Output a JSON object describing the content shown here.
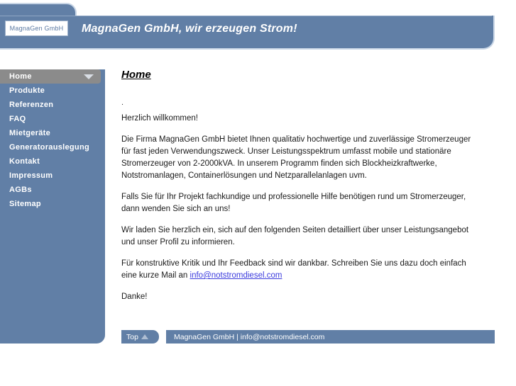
{
  "header": {
    "logo_text": "MagnaGen GmbH",
    "title": "MagnaGen GmbH, wir erzeugen Strom!",
    "dropdown_icon": "chevron-down-icon"
  },
  "sidebar": {
    "items": [
      {
        "label": "Home",
        "active": true
      },
      {
        "label": "Produkte",
        "active": false
      },
      {
        "label": "Referenzen",
        "active": false
      },
      {
        "label": "FAQ",
        "active": false
      },
      {
        "label": "Mietgeräte",
        "active": false
      },
      {
        "label": "Generatorauslegung",
        "active": false
      },
      {
        "label": "Kontakt",
        "active": false
      },
      {
        "label": "Impressum",
        "active": false
      },
      {
        "label": "AGBs",
        "active": false
      },
      {
        "label": "Sitemap",
        "active": false
      }
    ]
  },
  "main": {
    "page_title": "Home",
    "dot": ".",
    "greeting": "Herzlich willkommen!",
    "paragraph_1": "Die Firma MagnaGen GmbH bietet Ihnen qualitativ hochwertige und zuverlässige Stromerzeuger für fast jeden Verwendungszweck. Unser Leistungsspektrum umfasst mobile und stationäre Stromerzeuger von 2-2000kVA. In unserem Programm finden sich Blockheizkraftwerke, Notstromanlagen, Containerlösungen und Netzparallelanlagen uvm.",
    "paragraph_2": "Falls Sie für Ihr Projekt fachkundige und professionelle Hilfe benötigen rund um Stromerzeuger, dann wenden Sie sich an uns!",
    "paragraph_3": "Wir laden Sie herzlich ein, sich auf den folgenden Seiten detailliert über unser Leistungsangebot und unser Profil zu informieren.",
    "paragraph_4_before": "Für konstruktive Kritik und Ihr Feedback sind wir dankbar. Schreiben Sie uns dazu doch einfach eine kurze Mail an ",
    "email_link": "info@notstromdiesel.com",
    "paragraph_5": "Danke!"
  },
  "footer": {
    "top_label": "Top",
    "top_icon": "triangle-up-icon",
    "copyright": "MagnaGen GmbH | info@notstromdiesel.com"
  },
  "colors": {
    "brand_blue": "#617fa6",
    "border_light": "#c9d6e6",
    "active_nav_gray": "#8b8b8b",
    "link_blue": "#3b3bdd"
  }
}
